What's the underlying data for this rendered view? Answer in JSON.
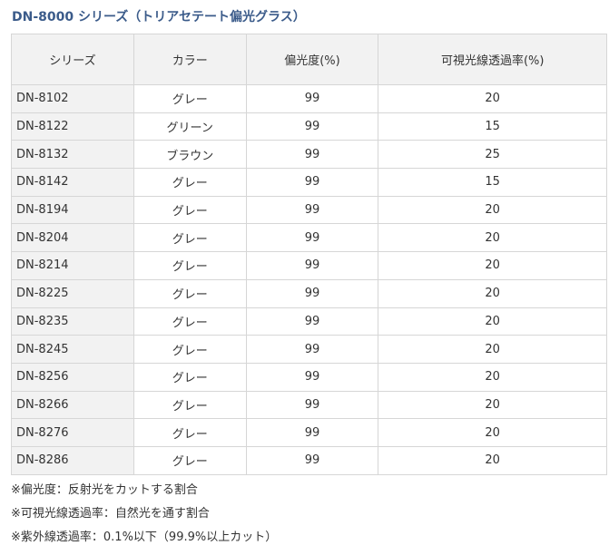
{
  "title": "DN-8000 シリーズ（トリアセテート偏光グラス）",
  "table": {
    "headers": [
      "シリーズ",
      "カラー",
      "偏光度(%)",
      "可視光線透過率(%)"
    ],
    "rows": [
      {
        "series": "DN-8102",
        "color": "グレー",
        "polarization": "99",
        "transmittance": "20"
      },
      {
        "series": "DN-8122",
        "color": "グリーン",
        "polarization": "99",
        "transmittance": "15"
      },
      {
        "series": "DN-8132",
        "color": "ブラウン",
        "polarization": "99",
        "transmittance": "25"
      },
      {
        "series": "DN-8142",
        "color": "グレー",
        "polarization": "99",
        "transmittance": "15"
      },
      {
        "series": "DN-8194",
        "color": "グレー",
        "polarization": "99",
        "transmittance": "20"
      },
      {
        "series": "DN-8204",
        "color": "グレー",
        "polarization": "99",
        "transmittance": "20"
      },
      {
        "series": "DN-8214",
        "color": "グレー",
        "polarization": "99",
        "transmittance": "20"
      },
      {
        "series": "DN-8225",
        "color": "グレー",
        "polarization": "99",
        "transmittance": "20"
      },
      {
        "series": "DN-8235",
        "color": "グレー",
        "polarization": "99",
        "transmittance": "20"
      },
      {
        "series": "DN-8245",
        "color": "グレー",
        "polarization": "99",
        "transmittance": "20"
      },
      {
        "series": "DN-8256",
        "color": "グレー",
        "polarization": "99",
        "transmittance": "20"
      },
      {
        "series": "DN-8266",
        "color": "グレー",
        "polarization": "99",
        "transmittance": "20"
      },
      {
        "series": "DN-8276",
        "color": "グレー",
        "polarization": "99",
        "transmittance": "20"
      },
      {
        "series": "DN-8286",
        "color": "グレー",
        "polarization": "99",
        "transmittance": "20"
      }
    ]
  },
  "notes": [
    "※偏光度：反射光をカットする割合",
    "※可視光線透過率：自然光を通す割合",
    "※紫外線透過率：0.1%以下（99.9%以上カット）"
  ]
}
